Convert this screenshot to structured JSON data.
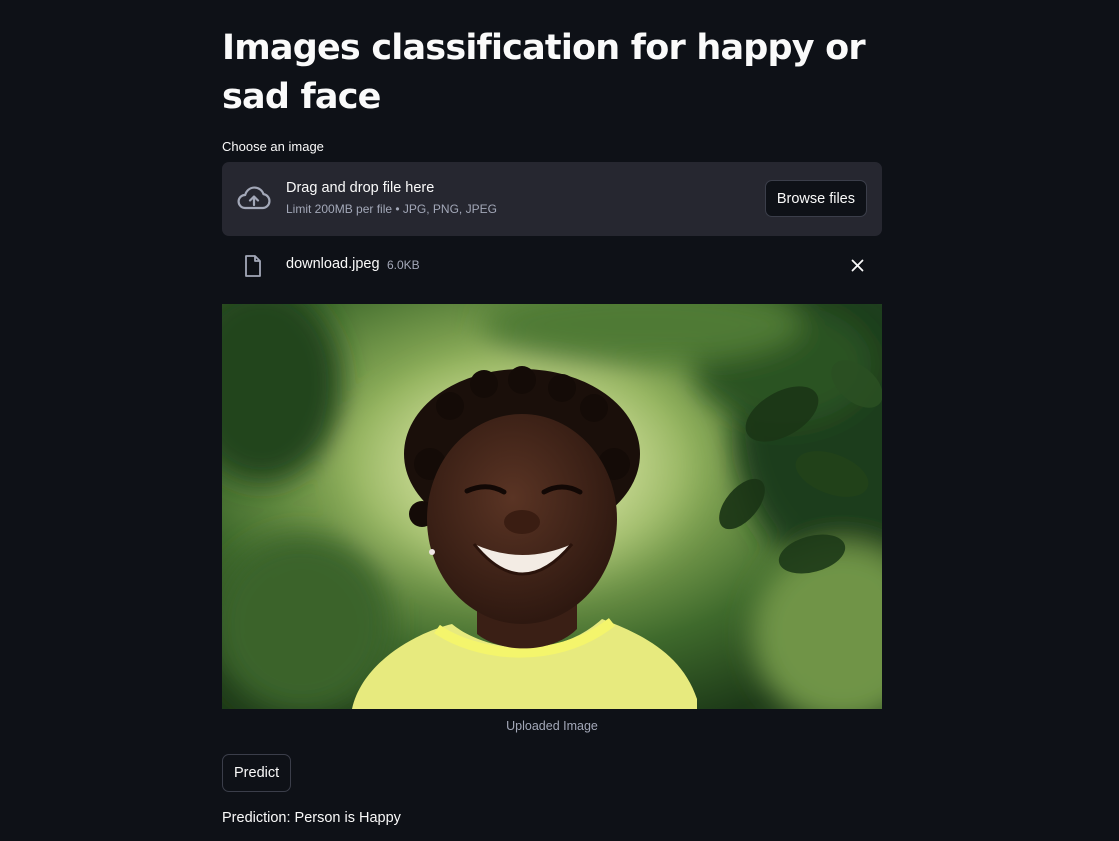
{
  "page": {
    "title": "Images classification for happy or sad face"
  },
  "uploader": {
    "label": "Choose an image",
    "drop_text": "Drag and drop file here",
    "limit_text": "Limit 200MB per file • JPG, PNG, JPEG",
    "browse_label": "Browse files",
    "icon": "cloud-upload-icon"
  },
  "file": {
    "name": "download.jpeg",
    "size": "6.0KB",
    "icon": "file-icon",
    "remove_icon": "close-icon"
  },
  "image": {
    "caption": "Uploaded Image"
  },
  "predict": {
    "button_label": "Predict",
    "result": "Prediction: Person is Happy"
  },
  "colors": {
    "background": "#0e1117",
    "dropzone": "#262730",
    "text": "#fafafa",
    "muted": "#a3a8b8"
  }
}
